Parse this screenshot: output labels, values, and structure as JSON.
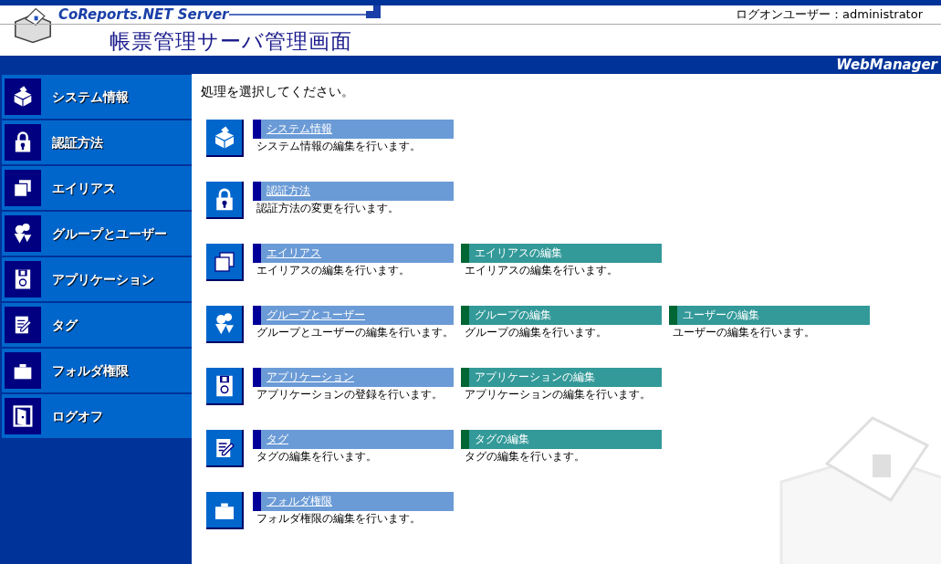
{
  "header": {
    "product": "CoReports.NET Server",
    "title": "帳票管理サーバ管理画面",
    "logon_label": "ログオンユーザー：",
    "logon_user": "administrator",
    "band_label": "WebManager"
  },
  "sidebar": {
    "items": [
      {
        "label": "システム情報"
      },
      {
        "label": "認証方法"
      },
      {
        "label": "エイリアス"
      },
      {
        "label": "グループとユーザー"
      },
      {
        "label": "アプリケーション"
      },
      {
        "label": "タグ"
      },
      {
        "label": "フォルダ権限"
      },
      {
        "label": "ログオフ"
      }
    ]
  },
  "main": {
    "prompt": "処理を選択してください。",
    "sections": [
      {
        "links": [
          {
            "kind": "main",
            "label": "システム情報",
            "description": "システム情報の編集を行います。"
          }
        ]
      },
      {
        "links": [
          {
            "kind": "main",
            "label": "認証方法",
            "description": "認証方法の変更を行います。"
          }
        ]
      },
      {
        "links": [
          {
            "kind": "main",
            "label": "エイリアス",
            "description": "エイリアスの編集を行います。"
          },
          {
            "kind": "sub",
            "label": "エイリアスの編集",
            "description": "エイリアスの編集を行います。"
          }
        ]
      },
      {
        "links": [
          {
            "kind": "main",
            "label": "グループとユーザー",
            "description": "グループとユーザーの編集を行います。"
          },
          {
            "kind": "sub",
            "label": "グループの編集",
            "description": "グループの編集を行います。"
          },
          {
            "kind": "sub",
            "label": "ユーザーの編集",
            "description": "ユーザーの編集を行います。"
          }
        ]
      },
      {
        "links": [
          {
            "kind": "main",
            "label": "アプリケーション",
            "description": "アプリケーションの登録を行います。"
          },
          {
            "kind": "sub",
            "label": "アプリケーションの編集",
            "description": "アプリケーションの編集を行います。"
          }
        ]
      },
      {
        "links": [
          {
            "kind": "main",
            "label": "タグ",
            "description": "タグの編集を行います。"
          },
          {
            "kind": "sub",
            "label": "タグの編集",
            "description": "タグの編集を行います。"
          }
        ]
      },
      {
        "links": [
          {
            "kind": "main",
            "label": "フォルダ権限",
            "description": "フォルダ権限の編集を行います。"
          }
        ]
      }
    ]
  }
}
